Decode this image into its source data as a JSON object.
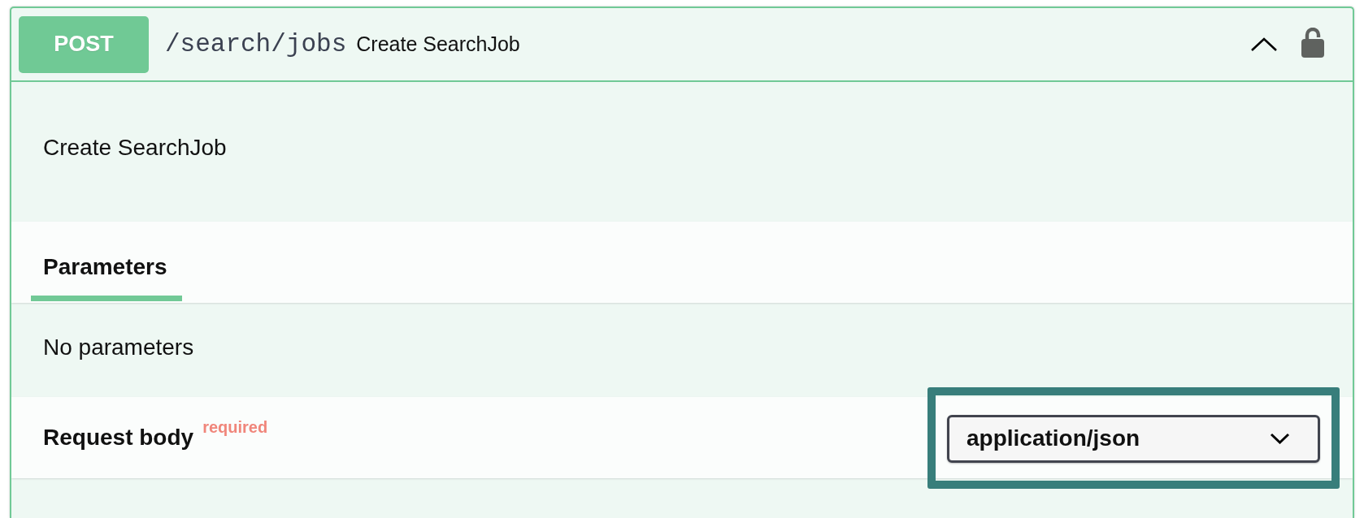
{
  "operation": {
    "method": "POST",
    "path": "/search/jobs",
    "summary": "Create SearchJob",
    "expanded": true,
    "locked": false
  },
  "description": "Create SearchJob",
  "tabs": [
    {
      "label": "Parameters",
      "selected": true
    }
  ],
  "parameters": {
    "empty_text": "No parameters"
  },
  "request_body": {
    "title": "Request body",
    "required_label": "required",
    "content_type": {
      "value": "application/json",
      "highlighted": true
    }
  }
}
